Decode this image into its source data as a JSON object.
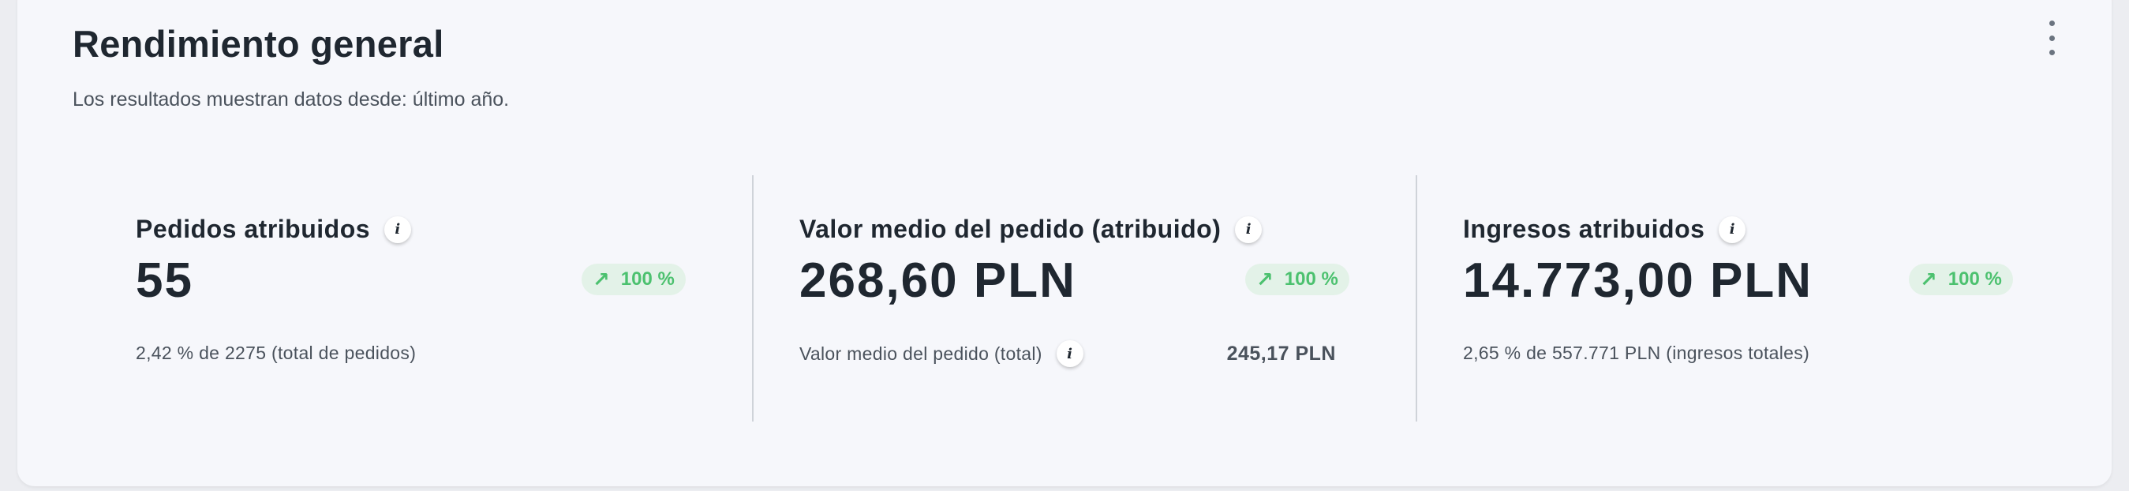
{
  "header": {
    "title": "Rendimiento general",
    "subtitle": "Los resultados muestran datos desde: último año.",
    "more_icon": "kebab-vertical-icon"
  },
  "colors": {
    "badge_text": "#4cc16f",
    "badge_bg": "#e3f2e8",
    "divider": "#cfd3d9",
    "card_bg": "#f6f7fb"
  },
  "metrics": [
    {
      "label": "Pedidos atribuidos",
      "info_icon": "info-icon",
      "value": "55",
      "trend_icon": "arrow-up-right-icon",
      "trend": "100 %",
      "footer": "2,42 % de 2275 (total de pedidos)"
    },
    {
      "label": "Valor medio del pedido (atribuido)",
      "info_icon": "info-icon",
      "value": "268,60 PLN",
      "trend_icon": "arrow-up-right-icon",
      "trend": "100 %",
      "footer_label": "Valor medio del pedido (total)",
      "footer_value": "245,17 PLN"
    },
    {
      "label": "Ingresos atribuidos",
      "info_icon": "info-icon",
      "value": "14.773,00 PLN",
      "trend_icon": "arrow-up-right-icon",
      "trend": "100 %",
      "footer": "2,65 % de 557.771 PLN (ingresos totales)"
    }
  ]
}
